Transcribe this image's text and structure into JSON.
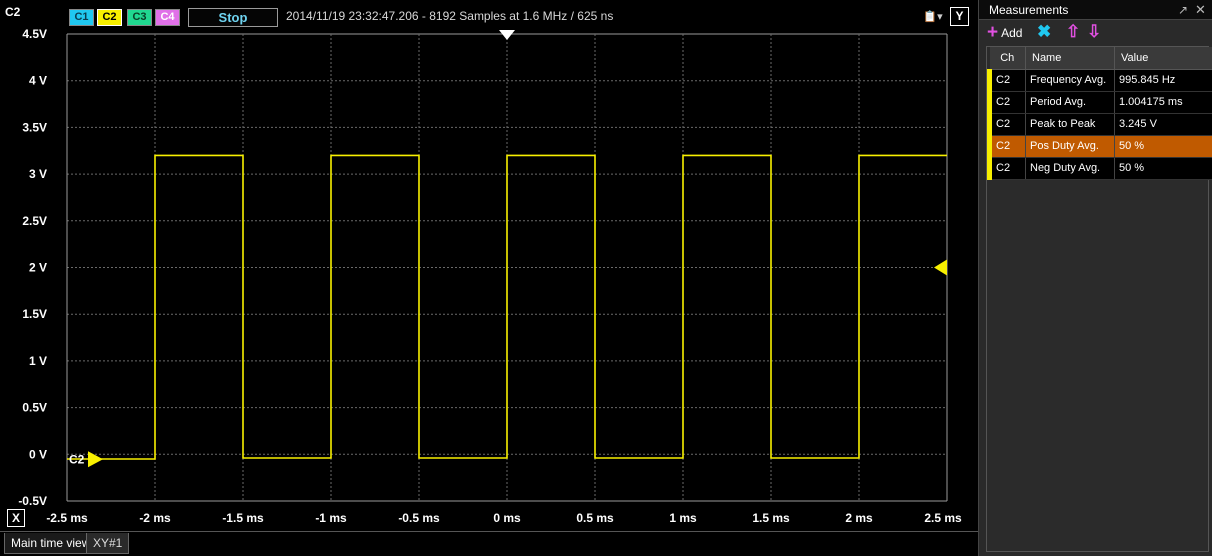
{
  "scope": {
    "channel_tag": "C2",
    "channel_buttons": [
      {
        "label": "C1",
        "color": "#20c8f0"
      },
      {
        "label": "C2",
        "color": "#f8f000"
      },
      {
        "label": "C3",
        "color": "#20d890"
      },
      {
        "label": "C4",
        "color": "#e070e8"
      }
    ],
    "run_state": "Stop",
    "acquisition_info": "2014/11/19 23:32:47.206 - 8192 Samples at 1.6 MHz / 625 ns",
    "y_button": "Y",
    "x_button": "X",
    "trace_marker_label": "C2",
    "export_icon": "export-icon"
  },
  "tabs": [
    {
      "label": "Main time view",
      "active": true
    },
    {
      "label": "XY#1",
      "active": false
    }
  ],
  "chart_data": {
    "type": "line",
    "series": [
      {
        "name": "C2",
        "color": "#f8f000",
        "x": [
          -2.5,
          -2.0,
          -2.0,
          -1.5,
          -1.5,
          -1.0,
          -1.0,
          -0.5,
          -0.5,
          0.0,
          0.0,
          0.5,
          0.5,
          1.0,
          1.0,
          1.5,
          1.5,
          2.0,
          2.0,
          2.5
        ],
        "y": [
          -0.05,
          -0.05,
          3.2,
          3.2,
          -0.04,
          -0.04,
          3.2,
          3.2,
          -0.04,
          -0.04,
          3.2,
          3.2,
          -0.04,
          -0.04,
          3.2,
          3.2,
          -0.04,
          -0.04,
          3.2,
          3.2
        ]
      }
    ],
    "xlim": [
      -2.5,
      2.5
    ],
    "ylim": [
      -0.5,
      4.5
    ],
    "x_ticks": [
      -2.5,
      -2.0,
      -1.5,
      -1.0,
      -0.5,
      0,
      0.5,
      1.0,
      1.5,
      2.0,
      2.5
    ],
    "x_tick_labels": [
      "-2.5 ms",
      "-2 ms",
      "-1.5 ms",
      "-1 ms",
      "-0.5 ms",
      "0 ms",
      "0.5 ms",
      "1 ms",
      "1.5 ms",
      "2 ms",
      "2.5 ms"
    ],
    "y_ticks": [
      -0.5,
      0,
      0.5,
      1,
      1.5,
      2,
      2.5,
      3,
      3.5,
      4,
      4.5
    ],
    "y_tick_labels": [
      "-0.5V",
      "0 V",
      "0.5V",
      "1 V",
      "1.5V",
      "2 V",
      "2.5V",
      "3 V",
      "3.5V",
      "4 V",
      "4.5V"
    ],
    "trigger_time": 0,
    "trigger_level": 2.0,
    "channel_offset": 0,
    "grid": true
  },
  "measurements": {
    "title": "Measurements",
    "add_label": "Add",
    "columns": [
      "Ch",
      "Name",
      "Value"
    ],
    "rows": [
      {
        "ch": "C2",
        "name": "Frequency Avg.",
        "value": "995.845 Hz",
        "selected": false
      },
      {
        "ch": "C2",
        "name": "Period Avg.",
        "value": "1.004175 ms",
        "selected": false
      },
      {
        "ch": "C2",
        "name": "Peak to Peak",
        "value": "3.245 V",
        "selected": false
      },
      {
        "ch": "C2",
        "name": "Pos Duty Avg.",
        "value": "50 %",
        "selected": true
      },
      {
        "ch": "C2",
        "name": "Neg Duty Avg.",
        "value": "50 %",
        "selected": false
      }
    ]
  }
}
